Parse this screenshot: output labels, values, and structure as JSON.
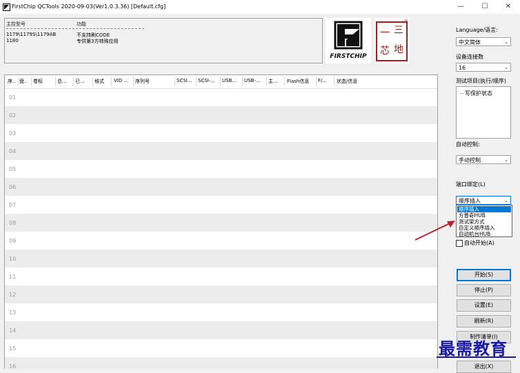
{
  "window": {
    "title": "FirstChip QCTools 2020-09-03(Ver1.0.3.36) [Default.cfg]",
    "controls": [
      "—",
      "☐",
      "✕"
    ]
  },
  "chip_info": {
    "headers": [
      "主控型号",
      "功能"
    ],
    "rows": [
      {
        "model": "1179\\1179S\\1179AB",
        "func": "不支持刷CODE"
      },
      {
        "model": "1180",
        "func": "专供第3方特殊应用"
      }
    ]
  },
  "logos": {
    "brand_text": "FIRSTCHIP",
    "seal_chars": [
      "一",
      "三",
      "芯",
      "地"
    ],
    "seal_mark": "®"
  },
  "grid": {
    "columns": [
      "序..",
      "盘..",
      "卷标",
      "总...",
      "已...",
      "格式",
      "VID ...",
      "序列号",
      "SCSI...",
      "SCSI-...",
      "USB...",
      "USB-...",
      "主...",
      "Flash信息",
      "F/...",
      "状态/信息"
    ],
    "rows": [
      "01",
      "02",
      "03",
      "04",
      "05",
      "06",
      "07",
      "08",
      "09",
      "10",
      "11",
      "12",
      "13",
      "14",
      "15",
      "16"
    ]
  },
  "sidebar": {
    "language_label": "Language/语言:",
    "language_value": "中文简体",
    "device_count_label": "设备连接数",
    "device_count_value": "16",
    "project_label": "测试项目(执行/顺序)",
    "project_items": [
      "写保护状态"
    ],
    "auto_control_label": "自动控制:",
    "auto_control_value": "手动控制",
    "port_binding_label": "端口绑定(L)",
    "port_binding_value": "顺序插入",
    "port_options": [
      "顺序插入",
      "方普奇HUB",
      "测试架方式",
      "自定义顺序插入",
      "自动机台HUB"
    ],
    "auto_start_label": "自动开始(A)",
    "buttons": {
      "start": "开始(S)",
      "stop": "停止(P)",
      "settings": "设置(E)",
      "refresh": "刷新(R)",
      "production": "制作清单(I)",
      "exit": "退出(X)"
    }
  },
  "watermark": "最需教育",
  "colors": {
    "selection": "#0078d7",
    "arrow": "#c0202a",
    "watermark": "#1a1aa6",
    "alt_row": "#ececec"
  }
}
